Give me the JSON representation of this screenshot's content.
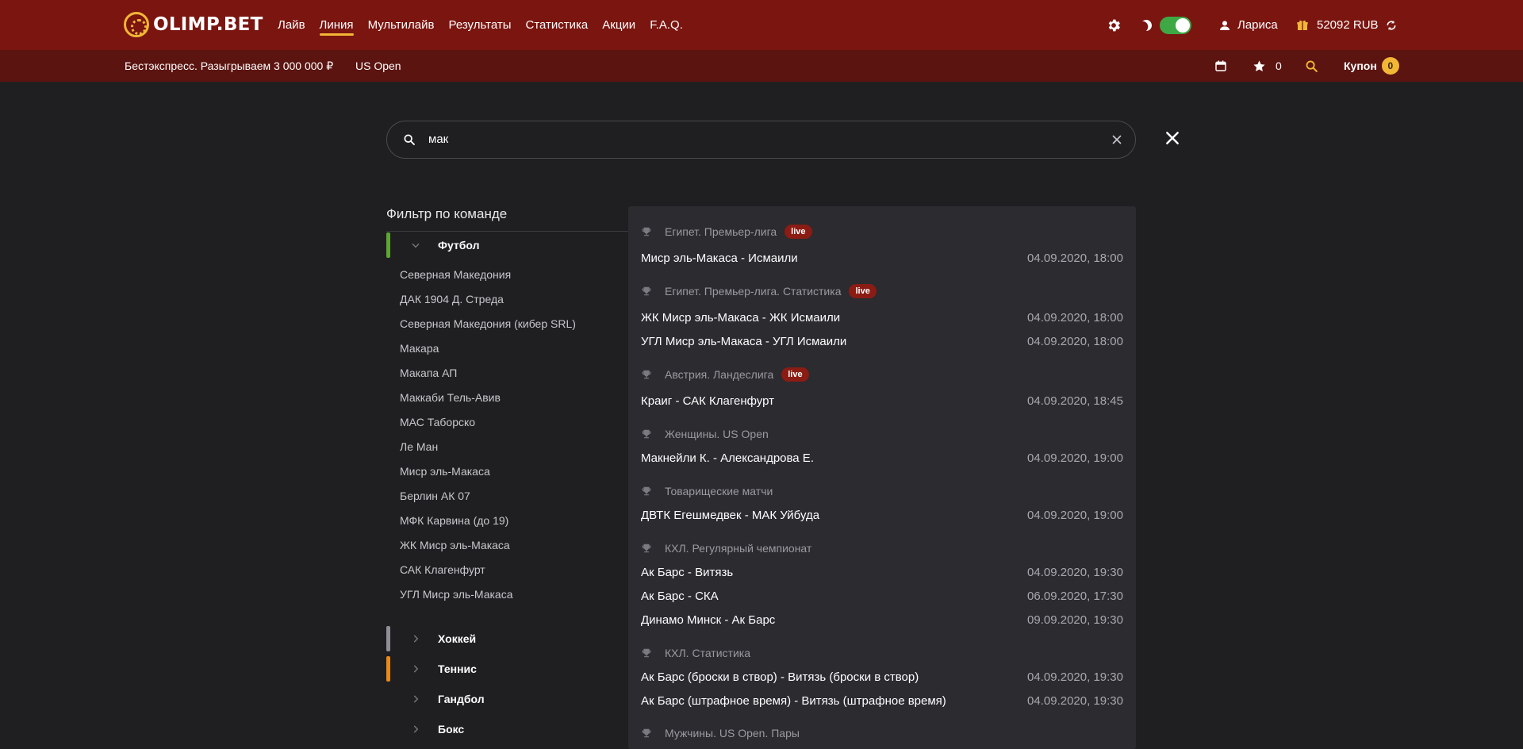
{
  "brand": {
    "name": "OLIMP.BET"
  },
  "nav": [
    "Лайв",
    "Линия",
    "Мультилайв",
    "Результаты",
    "Статистика",
    "Акции",
    "F.A.Q."
  ],
  "header": {
    "user_name": "Лариса",
    "balance": "52092 RUB"
  },
  "subbar": {
    "promo": "Бестэкспресс. Разыгрываем 3 000 000 ₽",
    "us_open": "US Open",
    "favorites_count": "0",
    "coupon_label": "Купон",
    "coupon_count": "0"
  },
  "search": {
    "value": "мак"
  },
  "filter": {
    "title": "Фильтр по команде",
    "sports": [
      {
        "label": "Футбол",
        "color": "#5ea534",
        "expanded": true
      },
      {
        "label": "Хоккей",
        "color": "#8e8e96",
        "expanded": false
      },
      {
        "label": "Теннис",
        "color": "#e88a1a",
        "expanded": false
      },
      {
        "label": "Гандбол",
        "color": "",
        "expanded": false
      },
      {
        "label": "Бокс",
        "color": "",
        "expanded": false
      }
    ],
    "teams": [
      "Северная Македония",
      "ДАК 1904 Д. Стреда",
      "Северная Македония (кибер SRL)",
      "Макара",
      "Макапа АП",
      "Маккаби Тель-Авив",
      "МАС Таборско",
      "Ле Ман",
      "Миср эль-Макаса",
      "Берлин АК 07",
      "МФК Карвина (до 19)",
      "ЖК Миср эль-Макаса",
      "САК Клагенфурт",
      "УГЛ Миср эль-Макаса"
    ]
  },
  "results": {
    "live_label": "live",
    "leagues": [
      {
        "name": "Египет. Премьер-лига",
        "live": true,
        "matches": [
          {
            "name": "Миср эль-Макаса - Исмаили",
            "date": "04.09.2020, 18:00"
          }
        ]
      },
      {
        "name": "Египет. Премьер-лига. Статистика",
        "live": true,
        "matches": [
          {
            "name": "ЖК Миср эль-Макаса - ЖК Исмаили",
            "date": "04.09.2020, 18:00"
          },
          {
            "name": "УГЛ Миср эль-Макаса - УГЛ Исмаили",
            "date": "04.09.2020, 18:00"
          }
        ]
      },
      {
        "name": "Австрия. Ландеслига",
        "live": true,
        "matches": [
          {
            "name": "Краиг - САК Клагенфурт",
            "date": "04.09.2020, 18:45"
          }
        ]
      },
      {
        "name": "Женщины. US Open",
        "live": false,
        "matches": [
          {
            "name": "Макнейли К. - Александрова Е.",
            "date": "04.09.2020, 19:00"
          }
        ]
      },
      {
        "name": "Товарищеские матчи",
        "live": false,
        "matches": [
          {
            "name": "ДВТК Егешмедвек - МАК Уйбуда",
            "date": "04.09.2020, 19:00"
          }
        ]
      },
      {
        "name": "КХЛ. Регулярный чемпионат",
        "live": false,
        "matches": [
          {
            "name": "Ак Барс - Витязь",
            "date": "04.09.2020, 19:30"
          },
          {
            "name": "Ак Барс - СКА",
            "date": "06.09.2020, 17:30"
          },
          {
            "name": "Динамо Минск - Ак Барс",
            "date": "09.09.2020, 19:30"
          }
        ]
      },
      {
        "name": "КХЛ. Статистика",
        "live": false,
        "matches": [
          {
            "name": "Ак Барс (броски в створ) - Витязь (броски в створ)",
            "date": "04.09.2020, 19:30"
          },
          {
            "name": "Ак Барс (штрафное время) - Витязь (штрафное время)",
            "date": "04.09.2020, 19:30"
          }
        ]
      },
      {
        "name": "Мужчины. US Open. Пары",
        "live": false,
        "matches": []
      }
    ]
  }
}
